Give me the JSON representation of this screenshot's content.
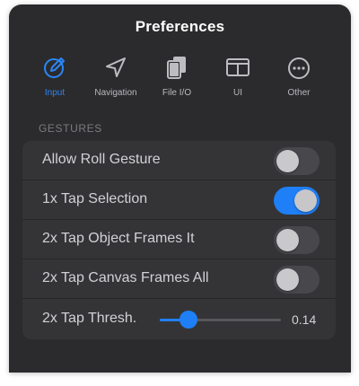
{
  "title": "Preferences",
  "tabs": [
    {
      "label": "Input",
      "icon": "pencil-circle-icon",
      "active": true
    },
    {
      "label": "Navigation",
      "icon": "location-arrow-icon",
      "active": false
    },
    {
      "label": "File I/O",
      "icon": "documents-icon",
      "active": false
    },
    {
      "label": "UI",
      "icon": "window-layout-icon",
      "active": false
    },
    {
      "label": "Other",
      "icon": "ellipsis-circle-icon",
      "active": false
    }
  ],
  "section": "GESTURES",
  "rows": [
    {
      "label": "Allow Roll Gesture",
      "on": false
    },
    {
      "label": "1x Tap Selection",
      "on": true
    },
    {
      "label": "2x Tap Object Frames It",
      "on": false
    },
    {
      "label": "2x Tap Canvas Frames All",
      "on": false
    }
  ],
  "threshold": {
    "label": "2x Tap Thresh.",
    "value_text": "0.14",
    "fraction": 0.24
  },
  "colors": {
    "accent": "#1f7ff6",
    "panel": "#2b2b2d",
    "group": "#343437"
  }
}
